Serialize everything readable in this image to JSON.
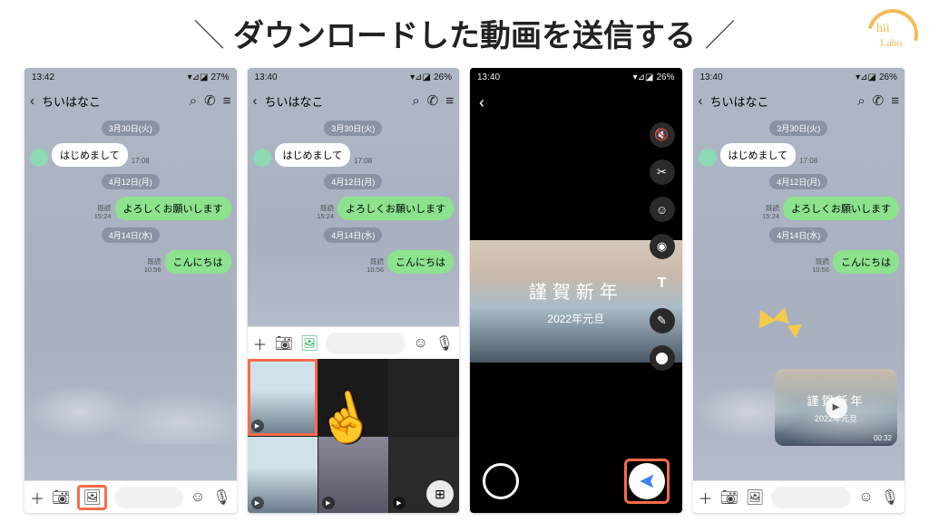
{
  "title": "ダウンロードした動画を送信する",
  "logo": {
    "line1": "hii",
    "line2": "Labo"
  },
  "status": {
    "time1": "13:42",
    "time2": "13:40",
    "time3": "13:40",
    "time4": "13:40",
    "bat1": "27%",
    "bat2": "26%",
    "bat3": "26%",
    "bat4": "26%"
  },
  "header": {
    "contact": "ちいはなこ"
  },
  "dates": {
    "d1": "3月30日(火)",
    "d2": "4月12日(月)",
    "d3": "4月14日(水)"
  },
  "msgs": {
    "in1": "はじめまして",
    "in1_ts": "17:08",
    "out1": "よろしくお願いします",
    "out1_read": "既読",
    "out1_ts": "15:24",
    "out2": "こんにちは",
    "out2_read": "既読",
    "out2_ts": "10:56"
  },
  "video": {
    "title": "謹賀新年",
    "subtitle": "2022年元旦",
    "dur": "00:32"
  }
}
